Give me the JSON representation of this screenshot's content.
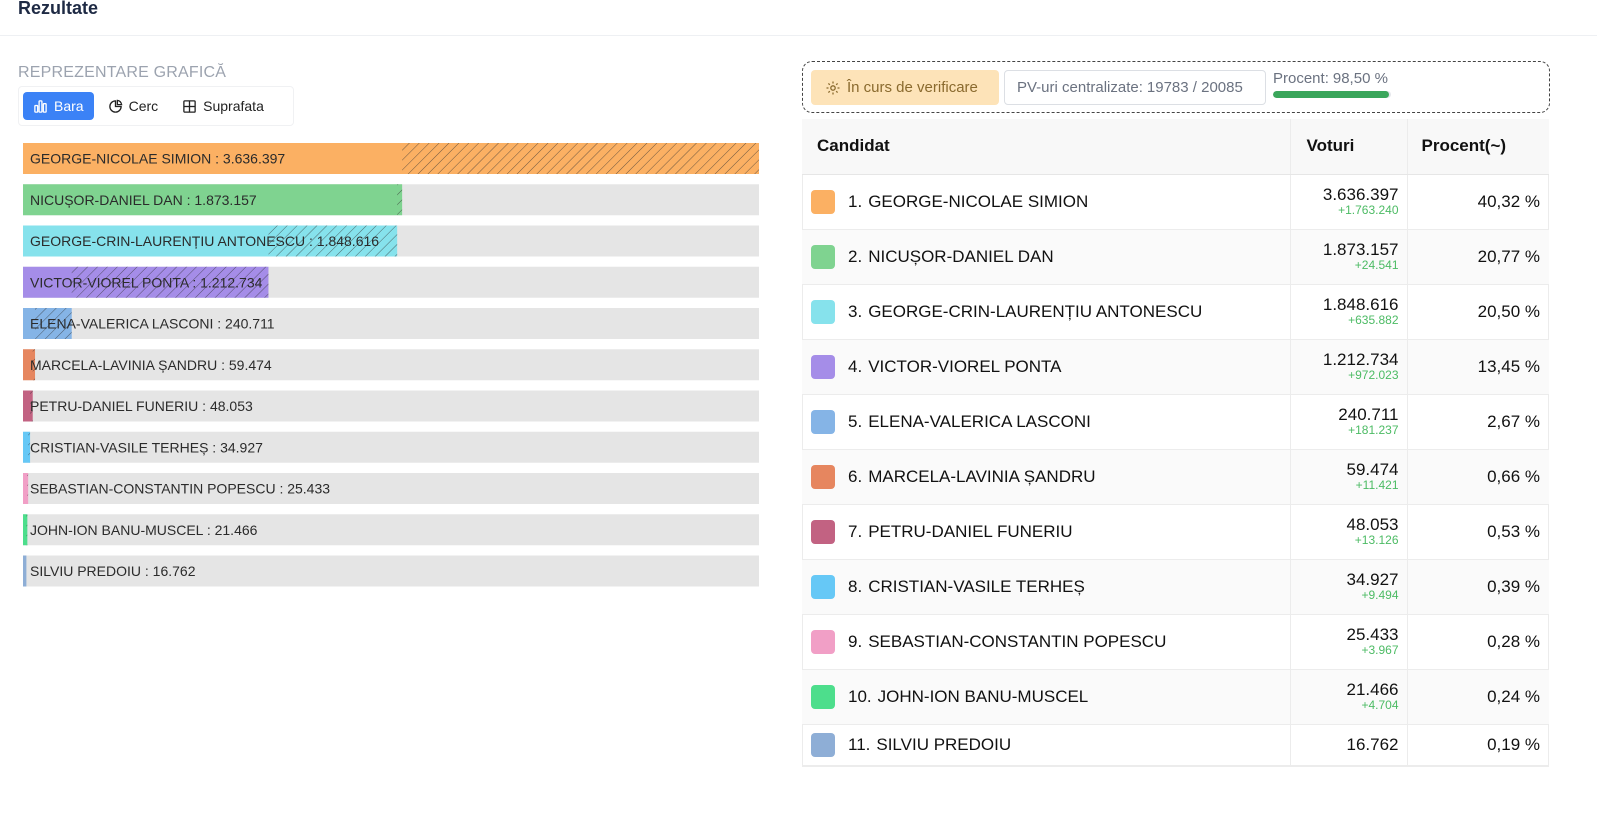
{
  "page": {
    "title": "Rezultate"
  },
  "chart_section": {
    "label": "REPREZENTARE GRAFICĂ"
  },
  "view_toggle": {
    "bar": "Bara",
    "circle": "Cerc",
    "surface": "Suprafata"
  },
  "status": {
    "badge": "În curs de verificare",
    "pv_label": "PV-uri centralizate:",
    "pv_value": "19783 / 20085",
    "pct_label": "Procent:",
    "pct_value": "98,50 %",
    "progress_fraction": 0.985,
    "progress_color": "#3aa65b"
  },
  "table": {
    "headers": {
      "candidate": "Candidat",
      "votes": "Voturi",
      "percent": "Procent(~)"
    },
    "rows": [
      {
        "rank": "1.",
        "name": "GEORGE-NICOLAE SIMION",
        "votes": "3.636.397",
        "delta": "+1.763.240",
        "percent": "40,32 %",
        "color": "#fbb063"
      },
      {
        "rank": "2.",
        "name": "NICUȘOR-DANIEL DAN",
        "votes": "1.873.157",
        "delta": "+24.541",
        "percent": "20,77 %",
        "color": "#7fd390"
      },
      {
        "rank": "3.",
        "name": "GEORGE-CRIN-LAURENȚIU ANTONESCU",
        "votes": "1.848.616",
        "delta": "+635.882",
        "percent": "20,50 %",
        "color": "#86e2ec"
      },
      {
        "rank": "4.",
        "name": "VICTOR-VIOREL PONTA",
        "votes": "1.212.734",
        "delta": "+972.023",
        "percent": "13,45 %",
        "color": "#a58de8"
      },
      {
        "rank": "5.",
        "name": "ELENA-VALERICA LASCONI",
        "votes": "240.711",
        "delta": "+181.237",
        "percent": "2,67 %",
        "color": "#85b4e6"
      },
      {
        "rank": "6.",
        "name": "MARCELA-LAVINIA ȘANDRU",
        "votes": "59.474",
        "delta": "+11.421",
        "percent": "0,66 %",
        "color": "#e6865f"
      },
      {
        "rank": "7.",
        "name": "PETRU-DANIEL FUNERIU",
        "votes": "48.053",
        "delta": "+13.126",
        "percent": "0,53 %",
        "color": "#c26282"
      },
      {
        "rank": "8.",
        "name": "CRISTIAN-VASILE TERHEȘ",
        "votes": "34.927",
        "delta": "+9.494",
        "percent": "0,39 %",
        "color": "#66c8f6"
      },
      {
        "rank": "9.",
        "name": "SEBASTIAN-CONSTANTIN POPESCU",
        "votes": "25.433",
        "delta": "+3.967",
        "percent": "0,28 %",
        "color": "#f19fc6"
      },
      {
        "rank": "10.",
        "name": "JOHN-ION BANU-MUSCEL",
        "votes": "21.466",
        "delta": "+4.704",
        "percent": "0,24 %",
        "color": "#4dde8c"
      },
      {
        "rank": "11.",
        "name": "SILVIU PREDOIU",
        "votes": "16.762",
        "delta": "",
        "percent": "0,19 %",
        "color": "#8eaed6"
      }
    ]
  },
  "chart_data": {
    "type": "bar",
    "orientation": "horizontal",
    "xlim": [
      0,
      3636397
    ],
    "track_color": "#e5e5e5",
    "categories": [
      "GEORGE-NICOLAE SIMION : 3.636.397",
      "NICUȘOR-DANIEL DAN : 1.873.157",
      "GEORGE-CRIN-LAURENȚIU ANTONESCU : 1.848.616",
      "VICTOR-VIOREL PONTA : 1.212.734",
      "ELENA-VALERICA LASCONI : 240.711",
      "MARCELA-LAVINIA ȘANDRU : 59.474",
      "PETRU-DANIEL FUNERIU : 48.053",
      "CRISTIAN-VASILE TERHEȘ : 34.927",
      "SEBASTIAN-CONSTANTIN POPESCU : 25.433",
      "JOHN-ION BANU-MUSCEL : 21.466",
      "SILVIU PREDOIU : 16.762"
    ],
    "values": [
      3636397,
      1873157,
      1848616,
      1212734,
      240711,
      59474,
      48053,
      34927,
      25433,
      21466,
      16762
    ],
    "deltas": [
      1763240,
      24541,
      635882,
      972023,
      181237,
      11421,
      13126,
      9494,
      3967,
      4704,
      0
    ],
    "colors": [
      "#fbb063",
      "#7fd390",
      "#86e2ec",
      "#a58de8",
      "#85b4e6",
      "#e6865f",
      "#c26282",
      "#66c8f6",
      "#f19fc6",
      "#4dde8c",
      "#8eaed6"
    ]
  }
}
